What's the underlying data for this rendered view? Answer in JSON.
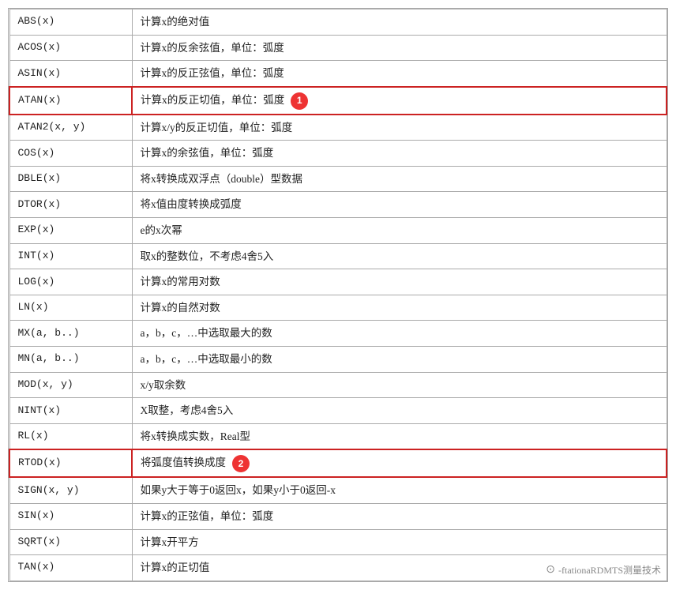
{
  "table": {
    "rows": [
      {
        "func": "ABS(x)",
        "desc": "计算x的绝对值",
        "highlight": false,
        "badge": null
      },
      {
        "func": "ACOS(x)",
        "desc": "计算x的反余弦值，单位：弧度",
        "highlight": false,
        "badge": null
      },
      {
        "func": "ASIN(x)",
        "desc": "计算x的反正弦值，单位：弧度",
        "highlight": false,
        "badge": null
      },
      {
        "func": "ATAN(x)",
        "desc": "计算x的反正切值，单位：弧度",
        "highlight": true,
        "badge": "1"
      },
      {
        "func": "ATAN2(x, y)",
        "desc": "计算x/y的反正切值，单位：弧度",
        "highlight": false,
        "badge": null
      },
      {
        "func": "COS(x)",
        "desc": "计算x的余弦值，单位：弧度",
        "highlight": false,
        "badge": null
      },
      {
        "func": "DBLE(x)",
        "desc": "将x转换成双浮点（double）型数据",
        "highlight": false,
        "badge": null
      },
      {
        "func": "DTOR(x)",
        "desc": "将x值由度转换成弧度",
        "highlight": false,
        "badge": null
      },
      {
        "func": "EXP(x)",
        "desc": "e的x次幂",
        "highlight": false,
        "badge": null
      },
      {
        "func": "INT(x)",
        "desc": "取x的整数位，不考虑4舍5入",
        "highlight": false,
        "badge": null
      },
      {
        "func": "LOG(x)",
        "desc": "计算x的常用对数",
        "highlight": false,
        "badge": null
      },
      {
        "func": "LN(x)",
        "desc": "计算x的自然对数",
        "highlight": false,
        "badge": null
      },
      {
        "func": "MX(a, b..)",
        "desc": "a，b，c，…中选取最大的数",
        "highlight": false,
        "badge": null
      },
      {
        "func": "MN(a, b..)",
        "desc": "a，b，c，…中选取最小的数",
        "highlight": false,
        "badge": null
      },
      {
        "func": "MOD(x, y)",
        "desc": "x/y取余数",
        "highlight": false,
        "badge": null
      },
      {
        "func": "NINT(x)",
        "desc": "X取整，考虑4舍5入",
        "highlight": false,
        "badge": null
      },
      {
        "func": "RL(x)",
        "desc": "将x转换成实数，Real型",
        "highlight": false,
        "badge": null
      },
      {
        "func": "RTOD(x)",
        "desc": "将弧度值转换成度",
        "highlight": true,
        "badge": "2"
      },
      {
        "func": "SIGN(x, y)",
        "desc": "如果y大于等于0返回x，如果y小于0返回-x",
        "highlight": false,
        "badge": null
      },
      {
        "func": "SIN(x)",
        "desc": "计算x的正弦值，单位：弧度",
        "highlight": false,
        "badge": null
      },
      {
        "func": "SQRT(x)",
        "desc": "计算x开平方",
        "highlight": false,
        "badge": null
      },
      {
        "func": "TAN(x)",
        "desc": "计算x的正切值",
        "highlight": false,
        "badge": null
      }
    ]
  },
  "watermark": {
    "text": "-ftationaRDMTS测量技术"
  }
}
